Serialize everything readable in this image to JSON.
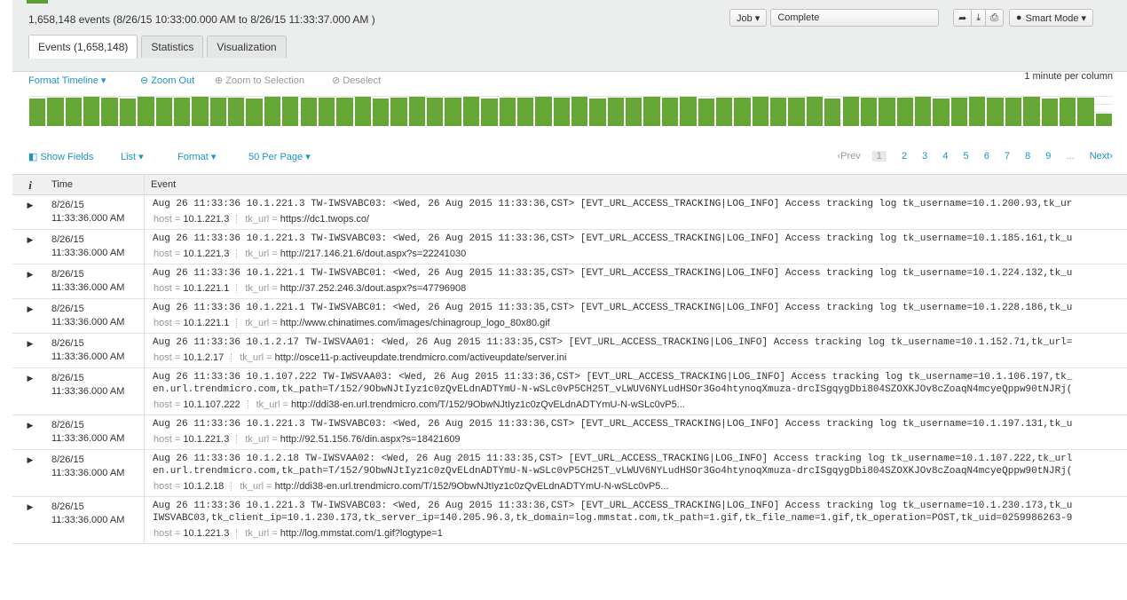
{
  "summary": "1,658,148 events (8/26/15 10:33:00.000 AM to 8/26/15 11:33:37.000 AM )",
  "job": {
    "label": "Job ▾",
    "status": "Complete",
    "mode": "Smart Mode ▾"
  },
  "tabs": [
    "Events (1,658,148)",
    "Statistics",
    "Visualization"
  ],
  "toolbar": {
    "format_timeline": "Format Timeline ▾",
    "zoom_out": "Zoom Out",
    "zoom_sel": "Zoom to Selection",
    "deselect": "Deselect",
    "scale": "1 minute per column"
  },
  "timeline_bars": [
    0.92,
    0.95,
    0.93,
    0.96,
    0.94,
    0.92,
    0.97,
    0.95,
    0.93,
    0.96,
    0.94,
    0.95,
    0.92,
    0.96,
    0.97,
    0.93,
    0.95,
    0.94,
    0.96,
    0.92,
    0.95,
    0.97,
    0.93,
    0.94,
    0.96,
    0.92,
    0.95,
    0.93,
    0.97,
    0.94,
    0.96,
    0.92,
    0.95,
    0.93,
    0.96,
    0.94,
    0.97,
    0.92,
    0.95,
    0.93,
    0.96,
    0.94,
    0.95,
    0.97,
    0.92,
    0.96,
    0.93,
    0.95,
    0.94,
    0.96,
    0.92,
    0.95,
    0.97,
    0.93,
    0.94,
    0.96,
    0.92,
    0.95,
    0.93,
    0.4
  ],
  "listbar": {
    "show_fields": "Show Fields",
    "list": "List ▾",
    "format": "Format ▾",
    "per_page": "50 Per Page ▾"
  },
  "pager": {
    "prev": "‹Prev",
    "pages": [
      "1",
      "2",
      "3",
      "4",
      "5",
      "6",
      "7",
      "8",
      "9",
      "..."
    ],
    "next": "Next›"
  },
  "columns": {
    "i": "i",
    "time": "Time",
    "event": "Event"
  },
  "events": [
    {
      "date": "8/26/15",
      "time": "11:33:36.000 AM",
      "lines": [
        "Aug 26 11:33:36 10.1.221.3 TW-IWSVABC03: <Wed, 26 Aug 2015 11:33:36,CST> [EVT_URL_ACCESS_TRACKING|LOG_INFO] Access tracking log tk_username=10.1.200.93,tk_ur"
      ],
      "host": "10.1.221.3",
      "url": "https://dc1.twops.co/"
    },
    {
      "date": "8/26/15",
      "time": "11:33:36.000 AM",
      "lines": [
        "Aug 26 11:33:36 10.1.221.3 TW-IWSVABC03: <Wed, 26 Aug 2015 11:33:36,CST> [EVT_URL_ACCESS_TRACKING|LOG_INFO] Access tracking log tk_username=10.1.185.161,tk_u"
      ],
      "host": "10.1.221.3",
      "url": "http://217.146.21.6/dout.aspx?s=22241030"
    },
    {
      "date": "8/26/15",
      "time": "11:33:36.000 AM",
      "lines": [
        "Aug 26 11:33:36 10.1.221.1 TW-IWSVABC01: <Wed, 26 Aug 2015 11:33:35,CST> [EVT_URL_ACCESS_TRACKING|LOG_INFO] Access tracking log tk_username=10.1.224.132,tk_u"
      ],
      "host": "10.1.221.1",
      "url": "http://37.252.246.3/dout.aspx?s=47796908"
    },
    {
      "date": "8/26/15",
      "time": "11:33:36.000 AM",
      "lines": [
        "Aug 26 11:33:36 10.1.221.1 TW-IWSVABC01: <Wed, 26 Aug 2015 11:33:35,CST> [EVT_URL_ACCESS_TRACKING|LOG_INFO] Access tracking log tk_username=10.1.228.186,tk_u"
      ],
      "host": "10.1.221.1",
      "url": "http://www.chinatimes.com/images/chinagroup_logo_80x80.gif"
    },
    {
      "date": "8/26/15",
      "time": "11:33:36.000 AM",
      "lines": [
        "Aug 26 11:33:36 10.1.2.17 TW-IWSVAA01: <Wed, 26 Aug 2015 11:33:35,CST> [EVT_URL_ACCESS_TRACKING|LOG_INFO] Access tracking log tk_username=10.1.152.71,tk_url="
      ],
      "host": "10.1.2.17",
      "url": "http://osce11-p.activeupdate.trendmicro.com/activeupdate/server.ini"
    },
    {
      "date": "8/26/15",
      "time": "11:33:36.000 AM",
      "lines": [
        "Aug 26 11:33:36 10.1.107.222 TW-IWSVAA03: <Wed, 26 Aug 2015 11:33:36,CST> [EVT_URL_ACCESS_TRACKING|LOG_INFO] Access tracking log tk_username=10.1.106.197,tk_",
        "en.url.trendmicro.com,tk_path=T/152/9ObwNJtIyz1c0zQvELdnADTYmU-N-wSLc0vP5CH25T_vLWUV6NYLudHSOr3Go4htynoqXmuza-drcISgqygDbi804SZOXKJOv8cZoaqN4mcyeQppw90tNJRj("
      ],
      "host": "10.1.107.222",
      "url": "http://ddi38-en.url.trendmicro.com/T/152/9ObwNJtIyz1c0zQvELdnADTYmU-N-wSLc0vP5..."
    },
    {
      "date": "8/26/15",
      "time": "11:33:36.000 AM",
      "lines": [
        "Aug 26 11:33:36 10.1.221.3 TW-IWSVABC03: <Wed, 26 Aug 2015 11:33:36,CST> [EVT_URL_ACCESS_TRACKING|LOG_INFO] Access tracking log tk_username=10.1.197.131,tk_u"
      ],
      "host": "10.1.221.3",
      "url": "http://92.51.156.76/din.aspx?s=18421609"
    },
    {
      "date": "8/26/15",
      "time": "11:33:36.000 AM",
      "lines": [
        "Aug 26 11:33:36 10.1.2.18 TW-IWSVAA02: <Wed, 26 Aug 2015 11:33:35,CST> [EVT_URL_ACCESS_TRACKING|LOG_INFO] Access tracking log tk_username=10.1.107.222,tk_url",
        "en.url.trendmicro.com,tk_path=T/152/9ObwNJtIyz1c0zQvELdnADTYmU-N-wSLc0vP5CH25T_vLWUV6NYLudHSOr3Go4htynoqXmuza-drcISgqygDbi804SZOXKJOv8cZoaqN4mcyeQppw90tNJRj("
      ],
      "host": "10.1.2.18",
      "url": "http://ddi38-en.url.trendmicro.com/T/152/9ObwNJtIyz1c0zQvELdnADTYmU-N-wSLc0vP5..."
    },
    {
      "date": "8/26/15",
      "time": "11:33:36.000 AM",
      "lines": [
        "Aug 26 11:33:36 10.1.221.3 TW-IWSVABC03: <Wed, 26 Aug 2015 11:33:36,CST> [EVT_URL_ACCESS_TRACKING|LOG_INFO] Access tracking log tk_username=10.1.230.173,tk_u",
        "IWSVABC03,tk_client_ip=10.1.230.173,tk_server_ip=140.205.96.3,tk_domain=log.mmstat.com,tk_path=1.gif,tk_file_name=1.gif,tk_operation=POST,tk_uid=0259986263-9"
      ],
      "host": "10.1.221.3",
      "url": "http://log.mmstat.com/1.gif?logtype=1"
    }
  ],
  "labels": {
    "host": "host =",
    "url": "tk_url ="
  },
  "colors": {
    "accent": "#65a637",
    "link": "#1e93c6"
  }
}
